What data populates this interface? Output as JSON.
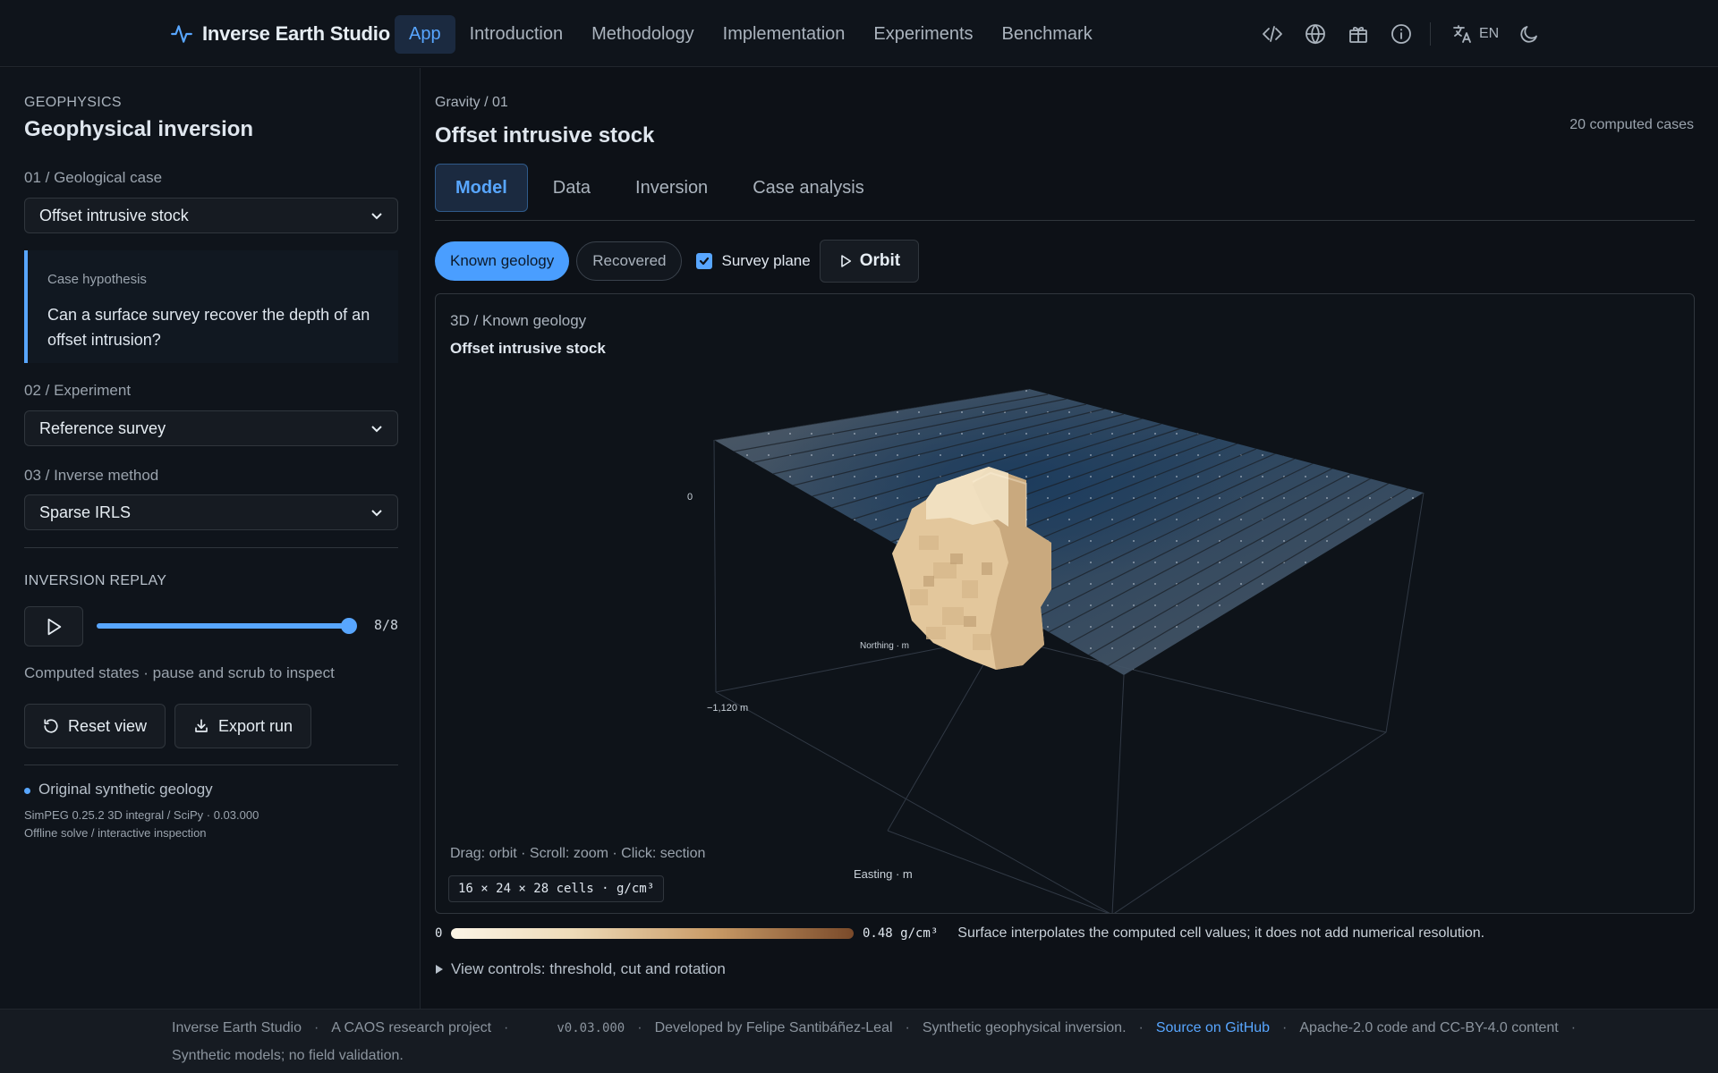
{
  "nav": {
    "brand": "Inverse Earth Studio",
    "links": [
      "App",
      "Introduction",
      "Methodology",
      "Implementation",
      "Experiments",
      "Benchmark"
    ],
    "active": "App",
    "icons": [
      "code-icon",
      "globe-icon",
      "gift-icon",
      "info-icon",
      "translate-icon",
      "moon-icon"
    ],
    "lang": "EN"
  },
  "sidebar": {
    "kicker": "GEOPHYSICS",
    "title": "Geophysical inversion",
    "case_label": "01 / Geological case",
    "case_value": "Offset intrusive stock",
    "hypothesis_kicker": "Case hypothesis",
    "hypothesis_text": "Can a surface survey recover the depth of an offset intrusion?",
    "experiment_label": "02 / Experiment",
    "experiment_value": "Reference survey",
    "method_label": "03 / Inverse method",
    "method_value": "Sparse IRLS",
    "replay_title": "INVERSION REPLAY",
    "replay_count": "8/8",
    "replay_progress": 1.0,
    "replay_note": "Computed states · pause and scrub to inspect",
    "reset_label": "Reset view",
    "export_label": "Export run",
    "legend_label": "Original synthetic geology",
    "meta_line1": "SimPEG 0.25.2 3D integral / SciPy · 0.03.000",
    "meta_line2": "Offline solve / interactive inspection"
  },
  "main": {
    "breadcrumb": "Gravity / 01",
    "title": "Offset intrusive stock",
    "count": "20 computed cases",
    "tabs": [
      "Model",
      "Data",
      "Inversion",
      "Case analysis"
    ],
    "active_tab": "Model",
    "toggle_known": "Known geology",
    "toggle_recovered": "Recovered",
    "survey_plane_label": "Survey plane",
    "survey_plane_checked": true,
    "orbit_label": "Orbit"
  },
  "viewer": {
    "kicker": "3D / Known geology",
    "title": "Offset intrusive stock",
    "axis_top": "0",
    "axis_bottom": "−1,120 m",
    "northing": "Northing · m",
    "easting": "Easting · m",
    "hint": "Drag: orbit · Scroll: zoom · Click: section",
    "cells": "16 × 24 × 28 cells · g/cm³"
  },
  "scale": {
    "min": "0",
    "max": "0.48 g/cm³",
    "note": "Surface interpolates the computed cell values; it does not add numerical resolution."
  },
  "details_label": "View controls: threshold, cut and rotation",
  "footer": {
    "items": [
      "Inverse Earth Studio",
      "A CAOS research project",
      "v0.03.000",
      "Developed by Felipe Santibáñez-Leal",
      "Synthetic geophysical inversion.",
      "Source on GitHub",
      "Apache-2.0 code and CC-BY-4.0 content"
    ],
    "line2": "Synthetic models; no field validation."
  },
  "colors": {
    "accent": "#58a6ff",
    "background": "#0d1117",
    "body_light": "#f2e2c4",
    "body_dark": "#c9a97e"
  }
}
